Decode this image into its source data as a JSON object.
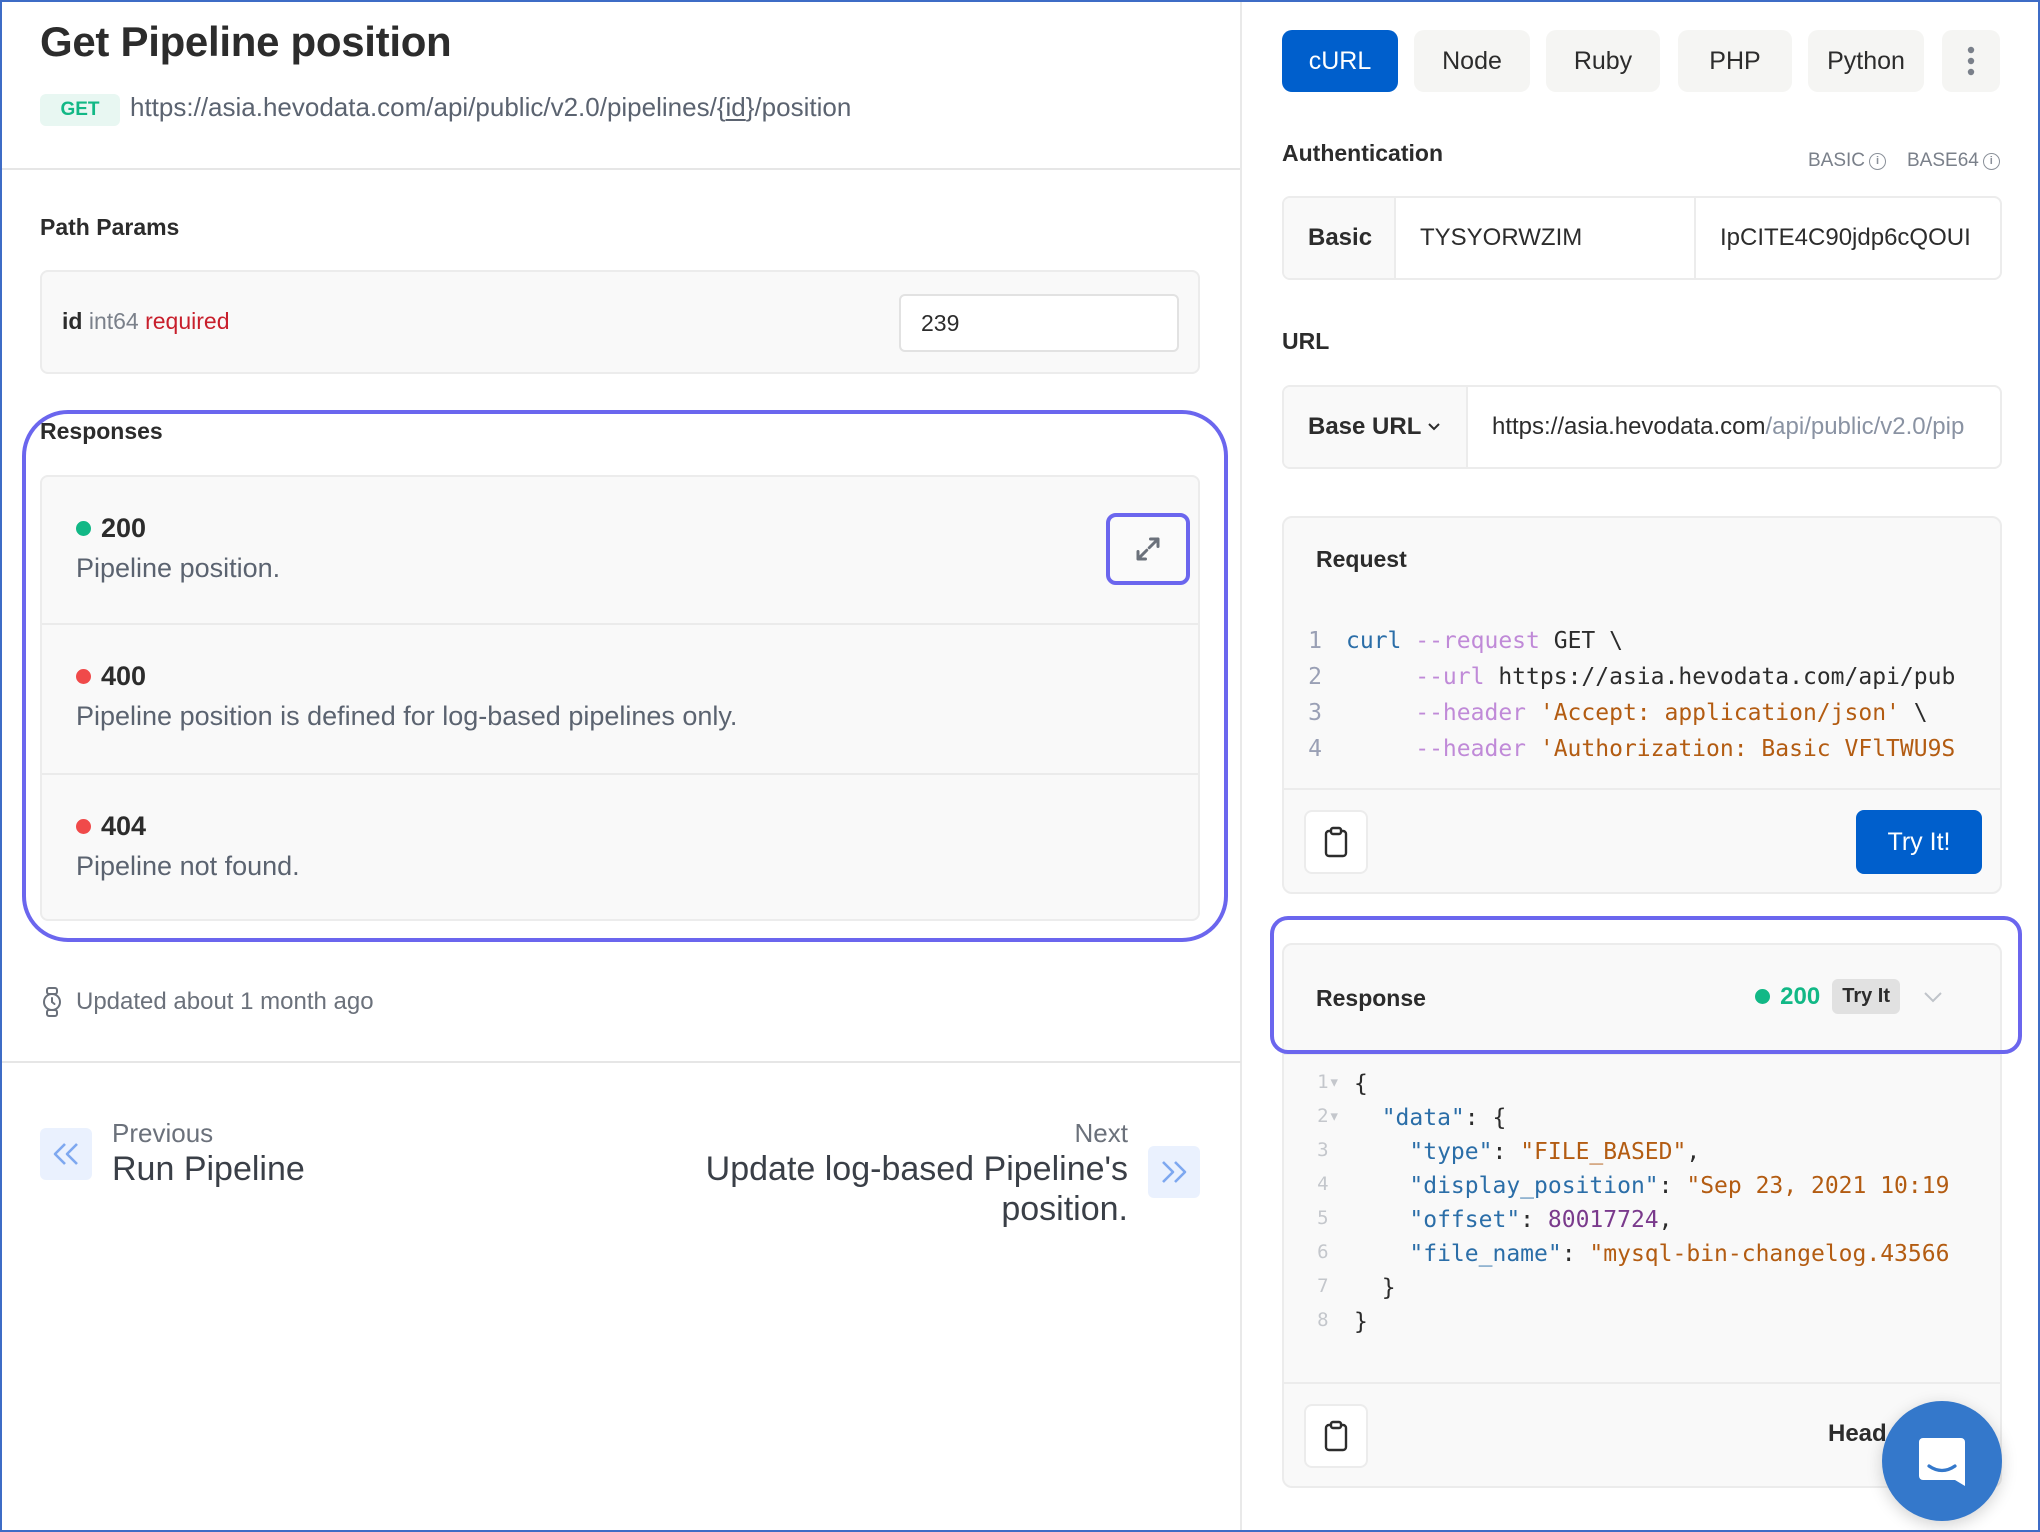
{
  "header": {
    "title": "Get Pipeline position",
    "method": "GET",
    "url_prefix": "https://asia.hevodata.com/api/public/v2.0/pipelines/",
    "url_brace_open": "{",
    "url_param": "id",
    "url_brace_close": "}",
    "url_suffix": "/position"
  },
  "path_params": {
    "label": "Path Params",
    "params": [
      {
        "name": "id",
        "type": "int64",
        "required_label": "required",
        "value": "239"
      }
    ]
  },
  "responses": {
    "label": "Responses",
    "items": [
      {
        "code": "200",
        "description": "Pipeline position.",
        "status_color": "#12b886"
      },
      {
        "code": "400",
        "description": "Pipeline position is defined for log-based pipelines only.",
        "status_color": "#f04a4a"
      },
      {
        "code": "404",
        "description": "Pipeline not found.",
        "status_color": "#f04a4a"
      }
    ]
  },
  "updated": {
    "text": "Updated about 1 month ago",
    "icon": "watch-icon"
  },
  "pagination": {
    "previous_label": "Previous",
    "previous_title": "Run Pipeline",
    "next_label": "Next",
    "next_title_line1": "Update log-based Pipeline's",
    "next_title_line2": "position."
  },
  "languages": {
    "tabs": [
      "cURL",
      "Node",
      "Ruby",
      "PHP",
      "Python"
    ],
    "active": "cURL",
    "more_icon": "more-vertical-icon"
  },
  "authentication": {
    "label": "Authentication",
    "hints": [
      "BASIC",
      "BASE64"
    ],
    "scheme": "Basic",
    "username": "TYSYORWZIM",
    "password": "IpCITE4C90jdp6cQOUI"
  },
  "url_section": {
    "label": "URL",
    "base_url_label": "Base URL",
    "base_host": "https://asia.hevodata.com",
    "base_path": "/api/public/v2.0/pip"
  },
  "request": {
    "title": "Request",
    "lines": [
      {
        "n": "1",
        "parts": [
          {
            "t": "curl",
            "c": "c-kw"
          },
          {
            "t": " --request",
            "c": "c-flag"
          },
          {
            "t": " GET \\",
            "c": "c-txt"
          }
        ]
      },
      {
        "n": "2",
        "parts": [
          {
            "t": "     --url",
            "c": "c-flag"
          },
          {
            "t": " https://asia.hevodata.com/api/pub",
            "c": "c-txt"
          }
        ]
      },
      {
        "n": "3",
        "parts": [
          {
            "t": "     --header",
            "c": "c-flag"
          },
          {
            "t": " 'Accept: application/json'",
            "c": "c-str"
          },
          {
            "t": " \\",
            "c": "c-txt"
          }
        ]
      },
      {
        "n": "4",
        "parts": [
          {
            "t": "     --header",
            "c": "c-flag"
          },
          {
            "t": " 'Authorization: Basic VFlTWU9S",
            "c": "c-str"
          }
        ]
      }
    ],
    "try_label": "Try It!"
  },
  "response": {
    "title": "Response",
    "status_code": "200",
    "status_color": "#12b886",
    "badge": "Try It",
    "lines": [
      {
        "n": "1",
        "fold": true,
        "parts": [
          {
            "t": "{",
            "c": "c-txt"
          }
        ]
      },
      {
        "n": "2",
        "fold": true,
        "parts": [
          {
            "t": "  \"data\"",
            "c": "c-key"
          },
          {
            "t": ": {",
            "c": "c-txt"
          }
        ]
      },
      {
        "n": "3",
        "fold": false,
        "parts": [
          {
            "t": "    \"type\"",
            "c": "c-key"
          },
          {
            "t": ": ",
            "c": "c-txt"
          },
          {
            "t": "\"FILE_BASED\"",
            "c": "c-str"
          },
          {
            "t": ",",
            "c": "c-txt"
          }
        ]
      },
      {
        "n": "4",
        "fold": false,
        "parts": [
          {
            "t": "    \"display_position\"",
            "c": "c-key"
          },
          {
            "t": ": ",
            "c": "c-txt"
          },
          {
            "t": "\"Sep 23, 2021 10:19",
            "c": "c-str"
          }
        ]
      },
      {
        "n": "5",
        "fold": false,
        "parts": [
          {
            "t": "    \"offset\"",
            "c": "c-key"
          },
          {
            "t": ": ",
            "c": "c-txt"
          },
          {
            "t": "80017724",
            "c": "c-num"
          },
          {
            "t": ",",
            "c": "c-txt"
          }
        ]
      },
      {
        "n": "6",
        "fold": false,
        "parts": [
          {
            "t": "    \"file_name\"",
            "c": "c-key"
          },
          {
            "t": ": ",
            "c": "c-txt"
          },
          {
            "t": "\"mysql-bin-changelog.43566",
            "c": "c-str"
          }
        ]
      },
      {
        "n": "7",
        "fold": false,
        "parts": [
          {
            "t": "  }",
            "c": "c-txt"
          }
        ]
      },
      {
        "n": "8",
        "fold": false,
        "parts": [
          {
            "t": "}",
            "c": "c-txt"
          }
        ]
      }
    ],
    "footer_label": "Head"
  },
  "colors": {
    "accent": "#005fcc",
    "highlight": "#6b66ee",
    "success": "#12b886",
    "error": "#f04a4a",
    "chat": "#3478cb"
  }
}
